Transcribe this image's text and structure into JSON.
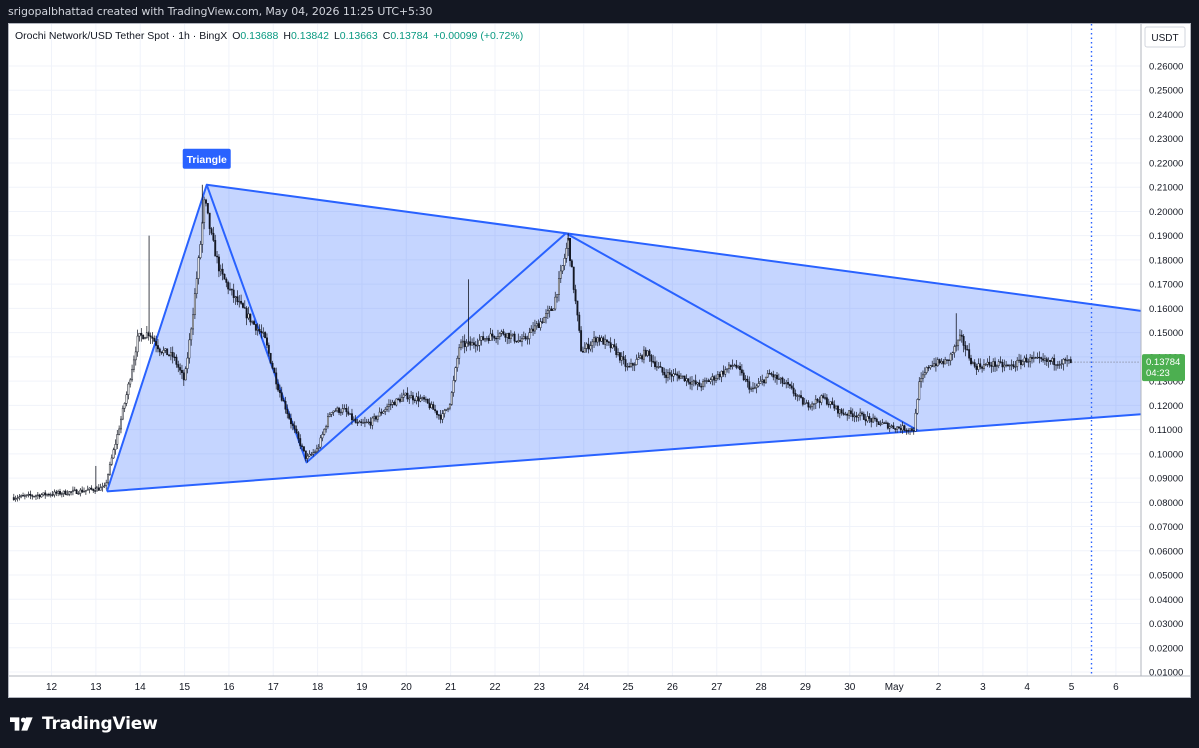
{
  "caption": "srigopalbhattad created with TradingView.com, May 04, 2026 11:25 UTC+5:30",
  "header": {
    "symbol": "Orochi Network/USD Tether Spot · 1h · BingX",
    "o_label": "O",
    "o_value": "0.13688",
    "h_label": "H",
    "h_value": "0.13842",
    "l_label": "L",
    "l_value": "0.13663",
    "c_label": "C",
    "c_value": "0.13784",
    "change": "+0.00099 (+0.72%)"
  },
  "currency": "USDT",
  "last_price_label": "0.13784",
  "countdown": "04:23",
  "pattern_label": "Triangle",
  "brand": "TradingView",
  "colors": {
    "pattern_fill": "#2962ff",
    "pattern_line": "#2962ff",
    "candle": "#131722",
    "last_price_badge": "#4caf50",
    "vline": "#2962ff"
  },
  "chart_data": {
    "type": "candlestick",
    "title": "Orochi Network/USD Tether Spot · 1h · BingX",
    "y_ticks": [
      0.01,
      0.02,
      0.03,
      0.04,
      0.05,
      0.06,
      0.07,
      0.08,
      0.09,
      0.1,
      0.11,
      0.12,
      0.13,
      0.14,
      0.15,
      0.16,
      0.17,
      0.18,
      0.19,
      0.2,
      0.21,
      0.22,
      0.23,
      0.24,
      0.25,
      0.26
    ],
    "y_tick_labels": [
      "0.01000",
      "0.02000",
      "0.03000",
      "0.04000",
      "0.05000",
      "0.06000",
      "0.07000",
      "0.08000",
      "0.09000",
      "0.10000",
      "0.11000",
      "0.12000",
      "0.13000",
      "0.14000",
      "0.15000",
      "0.16000",
      "0.17000",
      "0.18000",
      "0.19000",
      "0.20000",
      "0.21000",
      "0.22000",
      "0.23000",
      "0.24000",
      "0.25000",
      "0.26000"
    ],
    "ylim": [
      0.005,
      0.27
    ],
    "x_ticks": [
      12,
      13,
      14,
      15,
      16,
      17,
      18,
      19,
      20,
      21,
      22,
      23,
      24,
      25,
      26,
      27,
      28,
      29,
      30,
      31,
      32,
      33,
      34,
      35,
      36
    ],
    "x_tick_labels": [
      "12",
      "13",
      "14",
      "15",
      "16",
      "17",
      "18",
      "19",
      "20",
      "21",
      "22",
      "23",
      "24",
      "25",
      "26",
      "27",
      "28",
      "29",
      "30",
      "May",
      "2",
      "3",
      "4",
      "5",
      "6"
    ],
    "xlim": [
      11.15,
      36.5
    ],
    "last_price": 0.13784,
    "current_time": 35.45,
    "price_path": [
      [
        11.15,
        0.082
      ],
      [
        12.0,
        0.0835
      ],
      [
        12.6,
        0.0845
      ],
      [
        13.0,
        0.0855
      ],
      [
        13.2,
        0.086
      ],
      [
        13.45,
        0.105
      ],
      [
        13.7,
        0.125
      ],
      [
        13.95,
        0.148
      ],
      [
        14.2,
        0.15
      ],
      [
        14.45,
        0.143
      ],
      [
        14.75,
        0.14
      ],
      [
        15.0,
        0.13
      ],
      [
        15.2,
        0.16
      ],
      [
        15.35,
        0.185
      ],
      [
        15.45,
        0.205
      ],
      [
        15.6,
        0.19
      ],
      [
        15.8,
        0.175
      ],
      [
        16.1,
        0.165
      ],
      [
        16.5,
        0.155
      ],
      [
        16.8,
        0.148
      ],
      [
        17.1,
        0.128
      ],
      [
        17.4,
        0.113
      ],
      [
        17.75,
        0.098
      ],
      [
        18.0,
        0.102
      ],
      [
        18.3,
        0.118
      ],
      [
        18.6,
        0.118
      ],
      [
        18.9,
        0.112
      ],
      [
        19.2,
        0.113
      ],
      [
        19.6,
        0.12
      ],
      [
        20.0,
        0.124
      ],
      [
        20.4,
        0.122
      ],
      [
        20.8,
        0.115
      ],
      [
        21.0,
        0.122
      ],
      [
        21.2,
        0.145
      ],
      [
        21.45,
        0.145
      ],
      [
        21.8,
        0.148
      ],
      [
        22.2,
        0.15
      ],
      [
        22.6,
        0.146
      ],
      [
        22.9,
        0.152
      ],
      [
        23.3,
        0.16
      ],
      [
        23.5,
        0.175
      ],
      [
        23.65,
        0.188
      ],
      [
        23.8,
        0.165
      ],
      [
        23.95,
        0.142
      ],
      [
        24.3,
        0.148
      ],
      [
        24.7,
        0.143
      ],
      [
        25.0,
        0.135
      ],
      [
        25.4,
        0.142
      ],
      [
        25.8,
        0.133
      ],
      [
        26.2,
        0.132
      ],
      [
        26.6,
        0.128
      ],
      [
        27.0,
        0.132
      ],
      [
        27.4,
        0.137
      ],
      [
        27.8,
        0.126
      ],
      [
        28.2,
        0.133
      ],
      [
        28.6,
        0.128
      ],
      [
        29.0,
        0.12
      ],
      [
        29.4,
        0.123
      ],
      [
        29.8,
        0.117
      ],
      [
        30.2,
        0.116
      ],
      [
        30.6,
        0.113
      ],
      [
        31.0,
        0.111
      ],
      [
        31.45,
        0.11
      ],
      [
        31.55,
        0.128
      ],
      [
        31.8,
        0.137
      ],
      [
        32.2,
        0.138
      ],
      [
        32.5,
        0.148
      ],
      [
        32.8,
        0.136
      ],
      [
        33.2,
        0.137
      ],
      [
        33.6,
        0.136
      ],
      [
        34.0,
        0.139
      ],
      [
        34.4,
        0.138
      ],
      [
        34.8,
        0.138
      ],
      [
        35.0,
        0.1378
      ]
    ],
    "patterns": [
      {
        "name": "Triangle",
        "kind": "triangle",
        "points": [
          [
            13.25,
            0.0845
          ],
          [
            15.5,
            0.211
          ],
          [
            17.75,
            0.0965
          ],
          [
            23.6,
            0.191
          ],
          [
            31.55,
            0.1095
          ]
        ]
      }
    ]
  }
}
